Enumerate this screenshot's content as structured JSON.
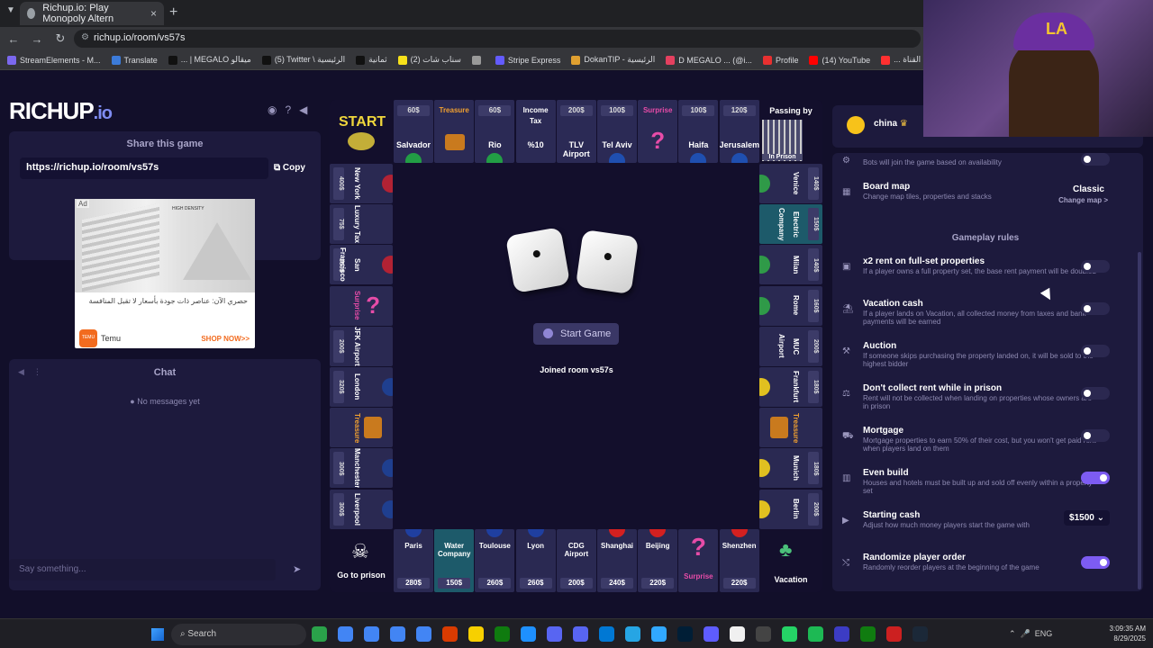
{
  "browser": {
    "tab_title": "Richup.io: Play Monopoly Altern",
    "url": "richup.io/room/vs57s",
    "bookmarks": [
      "StreamElements - M...",
      "Translate",
      "... | MEGALO ميقالو",
      "(5) Twitter \\ الرئيسية",
      "ثمانية",
      "(2) سناب شات",
      "",
      "Stripe Express",
      "DokanTIP - الرئيسية",
      "D MEGALO ... (@i...",
      "Profile",
      "(14) YouTube",
      "... مقالات حول القناة"
    ]
  },
  "left": {
    "logo_main": "RICHUP",
    "logo_suffix": ".io",
    "share_title": "Share this game",
    "share_url": "https://richup.io/room/vs57s",
    "copy_label": "Copy",
    "ad": {
      "tag": "Ad",
      "text": "حصري الآن: عناصر ذات جودة بأسعار لا تقبل المنافسة",
      "brand": "Temu",
      "cta": "SHOP NOW>>",
      "logo": "TEMU",
      "density": "HIGH DENSITY"
    },
    "chat_title": "Chat",
    "no_messages": "No messages yet",
    "chat_placeholder": "Say something..."
  },
  "board": {
    "corners": {
      "start": "START",
      "passing": "Passing by",
      "prison": "In Prison",
      "go_to_prison": "Go to prison",
      "vacation": "Vacation"
    },
    "top": [
      {
        "price": "60$",
        "name": "Salvador"
      },
      {
        "price": "Treasure",
        "name": ""
      },
      {
        "price": "60$",
        "name": "Rio"
      },
      {
        "price": "Income Tax",
        "name": "%10"
      },
      {
        "price": "200$",
        "name": "TLV Airport"
      },
      {
        "price": "100$",
        "name": "Tel Aviv"
      },
      {
        "price": "Surprise",
        "name": ""
      },
      {
        "price": "100$",
        "name": "Haifa"
      },
      {
        "price": "120$",
        "name": "Jerusalem"
      }
    ],
    "bottom": [
      {
        "price": "280$",
        "name": "Paris"
      },
      {
        "price": "150$",
        "name": "Water Company"
      },
      {
        "price": "260$",
        "name": "Toulouse"
      },
      {
        "price": "260$",
        "name": "Lyon"
      },
      {
        "price": "200$",
        "name": "CDG Airport"
      },
      {
        "price": "240$",
        "name": "Shanghai"
      },
      {
        "price": "220$",
        "name": "Beijing"
      },
      {
        "price": "",
        "name": "Surprise"
      },
      {
        "price": "220$",
        "name": "Shenzhen"
      }
    ],
    "left": [
      {
        "price": "400$",
        "name": "New York"
      },
      {
        "price": "75$",
        "name": "Luxury Tax"
      },
      {
        "price": "350$",
        "name": "San Francisco"
      },
      {
        "price": "",
        "name": "Surprise"
      },
      {
        "price": "200$",
        "name": "JFK Airport"
      },
      {
        "price": "320$",
        "name": "London"
      },
      {
        "price": "",
        "name": "Treasure"
      },
      {
        "price": "300$",
        "name": "Manchester"
      },
      {
        "price": "300$",
        "name": "Liverpool"
      }
    ],
    "right": [
      {
        "price": "140$",
        "name": "Venice"
      },
      {
        "price": "150$",
        "name": "Electric Company"
      },
      {
        "price": "140$",
        "name": "Milan"
      },
      {
        "price": "160$",
        "name": "Rome"
      },
      {
        "price": "200$",
        "name": "MUC Airport"
      },
      {
        "price": "180$",
        "name": "Frankfurt"
      },
      {
        "price": "",
        "name": "Treasure"
      },
      {
        "price": "180$",
        "name": "Munich"
      },
      {
        "price": "200$",
        "name": "Berlin"
      }
    ],
    "start_game": "Start Game",
    "joined": "Joined room vs57s"
  },
  "panel": {
    "user": "china",
    "rows": [
      {
        "title": "",
        "desc": "Bots will join the game based on availability",
        "on": false
      },
      {
        "title": "Board map",
        "desc": "Change map tiles, properties and stacks",
        "value": "Classic",
        "link": "Change map >"
      },
      {
        "title": "x2 rent on full-set properties",
        "desc": "If a player owns a full property set, the base rent payment will be doubled",
        "on": false
      },
      {
        "title": "Vacation cash",
        "desc": "If a player lands on Vacation, all collected money from taxes and bank payments will be earned",
        "on": false
      },
      {
        "title": "Auction",
        "desc": "If someone skips purchasing the property landed on, it will be sold to the highest bidder",
        "on": false
      },
      {
        "title": "Don't collect rent while in prison",
        "desc": "Rent will not be collected when landing on properties whose owners are in prison",
        "on": false
      },
      {
        "title": "Mortgage",
        "desc": "Mortgage properties to earn 50% of their cost, but you won't get paid rent when players land on them",
        "on": false
      },
      {
        "title": "Even build",
        "desc": "Houses and hotels must be built up and sold off evenly within a property set",
        "on": true
      },
      {
        "title": "Starting cash",
        "desc": "Adjust how much money players start the game with",
        "value": "$1500"
      },
      {
        "title": "Randomize player order",
        "desc": "Randomly reorder players at the beginning of the game",
        "on": true
      }
    ],
    "section": "Gameplay rules"
  },
  "taskbar": {
    "search": "Search",
    "lang": "ENG",
    "time": "3:09:35 AM",
    "date": "8/29/2025"
  },
  "colors": {
    "accent": "#7d5cf2",
    "bg": "#120f2a",
    "card": "#1d1a3d"
  }
}
